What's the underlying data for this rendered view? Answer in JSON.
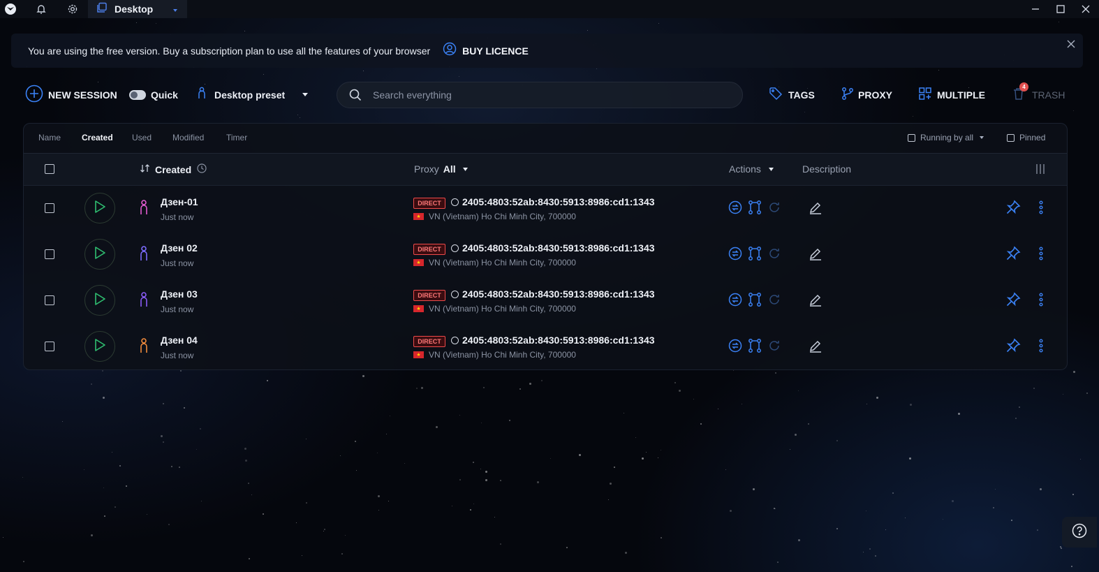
{
  "titlebar": {
    "app_icon": "app-logo-icon",
    "notifications_icon": "bell-icon",
    "settings_icon": "gear-icon",
    "tab_icon": "copy-icon",
    "tab_label": "Desktop",
    "tab_dropdown_icon": "caret-down-icon",
    "window_controls": [
      "minimize-icon",
      "maximize-icon",
      "close-icon"
    ]
  },
  "banner": {
    "message": "You are using the free version. Buy a subscription plan to use all the features of your browser",
    "button_label": "BUY LICENCE",
    "button_icon": "user-circle-icon",
    "close_icon": "close-icon"
  },
  "toolbar": {
    "new_session": "NEW SESSION",
    "quick_label": "Quick",
    "quick_on": false,
    "preset_label": "Desktop preset",
    "search_placeholder": "Search everything",
    "tags": "TAGS",
    "proxy": "PROXY",
    "multiple": "MULTIPLE",
    "trash": "TRASH",
    "trash_badge": "4"
  },
  "filters": {
    "tabs": [
      "Name",
      "Created",
      "Used",
      "Modified",
      "Timer"
    ],
    "active_tab": "Created",
    "running_label": "Running by all",
    "pinned_label": "Pinned"
  },
  "table": {
    "sort_column": "Created",
    "proxy_header": "Proxy",
    "proxy_filter": "All",
    "actions_header": "Actions",
    "description_header": "Description",
    "rows": [
      {
        "name": "Дзен-01",
        "time": "Just now",
        "icon_color": "#e35bd0",
        "proxy_type": "DIRECT",
        "ip": "2405:4803:52ab:8430:5913:8986:cd1:1343",
        "location": "VN (Vietnam) Ho Chi Minh City, 700000"
      },
      {
        "name": "Дзен 02",
        "time": "Just now",
        "icon_color": "#7d6cff",
        "proxy_type": "DIRECT",
        "ip": "2405:4803:52ab:8430:5913:8986:cd1:1343",
        "location": "VN (Vietnam) Ho Chi Minh City, 700000"
      },
      {
        "name": "Дзен 03",
        "time": "Just now",
        "icon_color": "#8a5cf6",
        "proxy_type": "DIRECT",
        "ip": "2405:4803:52ab:8430:5913:8986:cd1:1343",
        "location": "VN (Vietnam) Ho Chi Minh City, 700000"
      },
      {
        "name": "Дзен 04",
        "time": "Just now",
        "icon_color": "#f08a3c",
        "proxy_type": "DIRECT",
        "ip": "2405:4803:52ab:8430:5913:8986:cd1:1343",
        "location": "VN (Vietnam) Ho Chi Minh City, 700000"
      }
    ]
  },
  "colors": {
    "accent": "#3b82f6",
    "play": "#2fbf71",
    "direct": "#ef4a4a"
  },
  "help_icon": "question-circle-icon"
}
